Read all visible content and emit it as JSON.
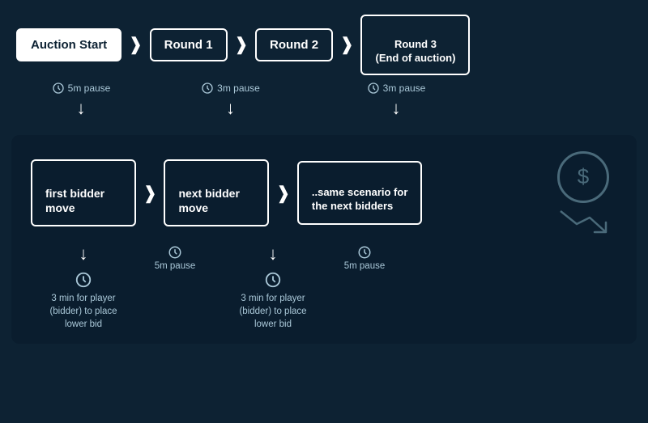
{
  "colors": {
    "bg": "#0d2233",
    "inner_bg": "#0a1d2e",
    "white": "#ffffff",
    "muted": "#aac8d8",
    "icon_gray": "#4a6a7a"
  },
  "top_flow": {
    "boxes": [
      {
        "id": "auction-start",
        "label": "Auction Start",
        "active": true
      },
      {
        "id": "round1",
        "label": "Round 1",
        "active": false
      },
      {
        "id": "round2",
        "label": "Round 2",
        "active": false
      },
      {
        "id": "round3",
        "label": "Round 3\n(End of auction)",
        "active": false
      }
    ],
    "pauses": [
      {
        "id": "pause1",
        "label": "5m pause"
      },
      {
        "id": "pause2",
        "label": "3m pause"
      },
      {
        "id": "pause3",
        "label": "3m pause"
      }
    ]
  },
  "bottom_flow": {
    "boxes": [
      {
        "id": "first-bidder",
        "label": "first bidder\nmove"
      },
      {
        "id": "next-bidder",
        "label": "next bidder\nmove"
      },
      {
        "id": "same-scenario",
        "label": "..same scenario for\nthe next bidders"
      }
    ],
    "pauses": [
      {
        "id": "b-pause1",
        "label": "5m pause"
      },
      {
        "id": "b-pause2",
        "label": "5m pause"
      }
    ],
    "descriptions": [
      {
        "id": "desc1",
        "text": "3 min for player (bidder) to place lower bid"
      },
      {
        "id": "desc2",
        "text": "3 min for player (bidder) to place lower bid"
      }
    ]
  }
}
